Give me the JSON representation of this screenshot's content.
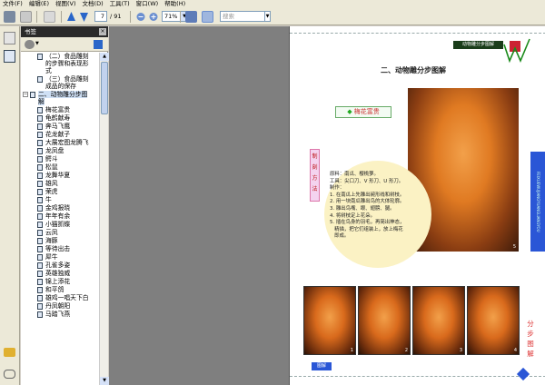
{
  "menu": [
    "文件(F)",
    "编辑(E)",
    "视图(V)",
    "文档(D)",
    "工具(T)",
    "窗口(W)",
    "帮助(H)"
  ],
  "toolbar": {
    "page_number": "7",
    "page_total": "/ 91",
    "zoom": "71%",
    "search_placeholder": "搜索"
  },
  "bookmarks": {
    "title": "书签",
    "close": "×",
    "items": [
      {
        "label": "（二）食品雕刻\n的步骤和表现形\n式",
        "indent": 2,
        "selected": false
      },
      {
        "label": "（三）食品雕刻\n成品的保存",
        "indent": 2,
        "selected": false
      },
      {
        "label": "二、动物雕分步图\n解",
        "indent": 1,
        "selected": true,
        "expander": "−"
      },
      {
        "label": "梅花富贵",
        "indent": 2,
        "selected": false
      },
      {
        "label": "龟鹤献寿",
        "indent": 2,
        "selected": false
      },
      {
        "label": "奔马飞鹰",
        "indent": 2,
        "selected": false
      },
      {
        "label": "花龙献子",
        "indent": 2,
        "selected": false
      },
      {
        "label": "大展宏图龙腾飞",
        "indent": 2,
        "selected": false
      },
      {
        "label": "龙凤盘",
        "indent": 2,
        "selected": false
      },
      {
        "label": "鳄斗",
        "indent": 2,
        "selected": false
      },
      {
        "label": "松鼠",
        "indent": 2,
        "selected": false
      },
      {
        "label": "龙舞华夏",
        "indent": 2,
        "selected": false
      },
      {
        "label": "雄风",
        "indent": 2,
        "selected": false
      },
      {
        "label": "荣虎",
        "indent": 2,
        "selected": false
      },
      {
        "label": "牛",
        "indent": 2,
        "selected": false
      },
      {
        "label": "金鸡报晓",
        "indent": 2,
        "selected": false
      },
      {
        "label": "年年有余",
        "indent": 2,
        "selected": false
      },
      {
        "label": "小猫抓蝶",
        "indent": 2,
        "selected": false
      },
      {
        "label": "云凤",
        "indent": 2,
        "selected": false
      },
      {
        "label": "海豚",
        "indent": 2,
        "selected": false
      },
      {
        "label": "等待出击",
        "indent": 2,
        "selected": false
      },
      {
        "label": "犀牛",
        "indent": 2,
        "selected": false
      },
      {
        "label": "孔雀多姿",
        "indent": 2,
        "selected": false
      },
      {
        "label": "英雄独威",
        "indent": 2,
        "selected": false
      },
      {
        "label": "锦上添花",
        "indent": 2,
        "selected": false
      },
      {
        "label": "和平鸽",
        "indent": 2,
        "selected": false
      },
      {
        "label": "雄鸡一唱天下白",
        "indent": 2,
        "selected": false
      },
      {
        "label": "丹凤朝阳",
        "indent": 2,
        "selected": false
      },
      {
        "label": "马踏飞燕",
        "indent": 2,
        "selected": false
      }
    ]
  },
  "page": {
    "header_band": "动物雕分步图解",
    "title": "二、动物雕分步图解",
    "dish_title": "梅花富贵",
    "method_tag": "制\n刻\n方\n法",
    "method_text": "原料：南瓜、樱桃萝。\n工具：尖口刀、V 形刀、U 形刀。\n制作：\n1. 在南瓜上先雕出碗形线和树枝。\n2. 用一块南瓜雕出鸟的大体轮廓。\n3. 雕出鸟嘴、眼、翅膀、腿。\n4. 将树枝定上花朵。\n5. 插在鸟身的羽毛，再简出神态，\n   精描，把它们组装上，放上梅花\n   即成。",
    "big_photo_number": "5",
    "thumb_numbers": [
      "1",
      "2",
      "3",
      "4"
    ],
    "side_label": "分\n步\n图\n解",
    "blue_bar_text": "FEIXUEWUJIANGYUANGLIANGYOU",
    "logo": "图解"
  }
}
